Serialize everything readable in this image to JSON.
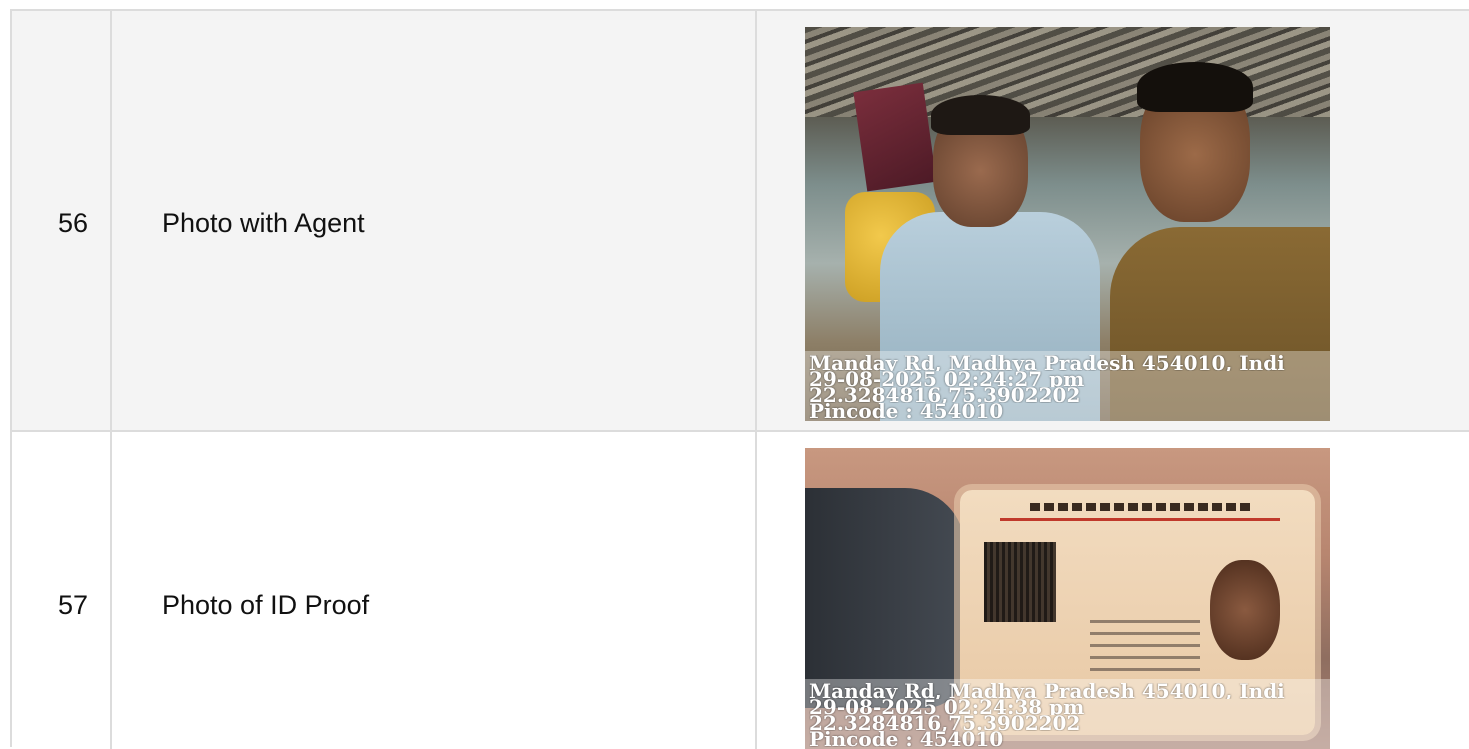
{
  "rows": [
    {
      "number": "56",
      "label": "Photo with Agent",
      "photo_overlay": {
        "address": "Manday Rd, Madhya Pradesh 454010, Indi",
        "datetime": "29-08-2025 02:24:27 pm",
        "coordinates": "22.3284816,75.3902202",
        "pincode": "Pincode : 454010"
      }
    },
    {
      "number": "57",
      "label": "Photo of ID Proof",
      "photo_overlay": {
        "address": "Manday Rd, Madhya Pradesh 454010, Indi",
        "datetime": "29-08-2025 02:24:38 pm",
        "coordinates": "22.3284816,75.3902202",
        "pincode": "Pincode : 454010"
      }
    }
  ]
}
